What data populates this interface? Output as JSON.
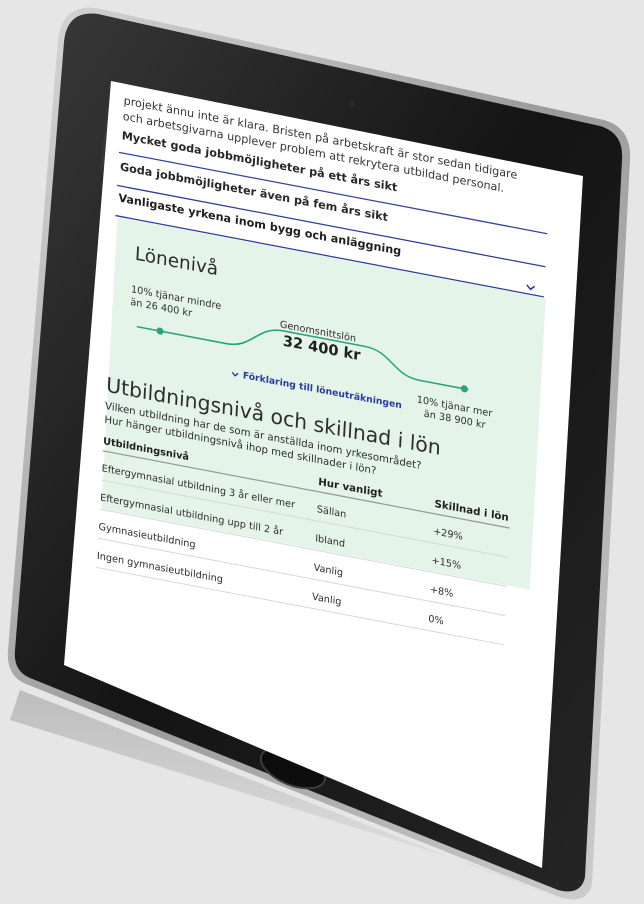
{
  "intro": {
    "line1": "projekt ännu inte är klara. Bristen på arbetskraft är stor sedan tidigare",
    "line2": "och arbetsgivarna upplever problem att rekrytera utbildad personal."
  },
  "accordion": [
    {
      "label": "Mycket goda jobbmöjligheter på ett års sikt"
    },
    {
      "label": "Goda jobbmöjligheter även på fem års sikt"
    },
    {
      "label": "Vanligaste yrkena inom bygg och anläggning"
    }
  ],
  "salary": {
    "title": "Lönenivå",
    "low_line1": "10% tjänar mindre",
    "low_line2": "än 26 400 kr",
    "avg_label": "Genomsnittslön",
    "avg_value": "32 400 kr",
    "high_line1": "10% tjänar mer",
    "high_line2": "än 38 900 kr",
    "explain_link": "Förklaring till löneuträkningen"
  },
  "education": {
    "title": "Utbildningsnivå och skillnad i lön",
    "sub1": "Vilken utbildning har de som är anställda inom yrkesområdet?",
    "sub2": "Hur hänger utbildningsnivå ihop med skillnader i lön?",
    "headers": [
      "Utbildningsnivå",
      "Hur vanligt",
      "Skillnad i lön"
    ],
    "rows": [
      {
        "level": "Eftergymnasial utbildning 3 år eller mer",
        "freq": "Sällan",
        "diff": "+29%"
      },
      {
        "level": "Eftergymnasial utbildning upp till 2 år",
        "freq": "Ibland",
        "diff": "+15%"
      },
      {
        "level": "Gymnasieutbildning",
        "freq": "Vanlig",
        "diff": "+8%"
      },
      {
        "level": "Ingen gymnasieutbildning",
        "freq": "Vanlig",
        "diff": "0%"
      }
    ]
  },
  "colors": {
    "accent_link": "#2a3aa0",
    "divider": "#2d3a9c",
    "salary_bg": "#e5f4e8",
    "curve": "#2aa37a"
  }
}
